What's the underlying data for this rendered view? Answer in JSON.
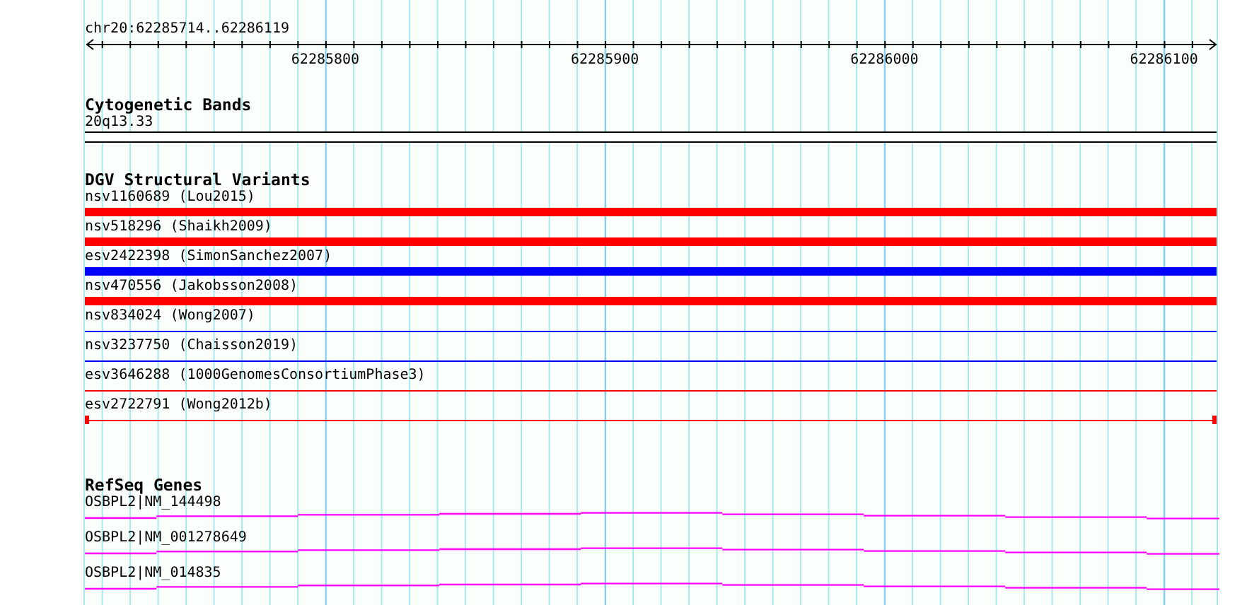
{
  "ruler": {
    "label": "chr20:62285714..62286119",
    "ticks": [
      "62285800",
      "62285900",
      "62286000",
      "62286100"
    ]
  },
  "tracks": [
    {
      "kind": "cytoband",
      "title": "Cytogenetic Bands",
      "features": [
        {
          "label": "20q13.33"
        }
      ]
    },
    {
      "kind": "variants",
      "title": "DGV Structural Variants",
      "features": [
        {
          "label": "nsv1160689 (Lou2015)",
          "kind": "bar",
          "color": "#ff0000"
        },
        {
          "label": "nsv518296 (Shaikh2009)",
          "kind": "bar",
          "color": "#ff0000"
        },
        {
          "label": "esv2422398 (SimonSanchez2007)",
          "kind": "bar",
          "color": "#0000ff"
        },
        {
          "label": "nsv470556 (Jakobsson2008)",
          "kind": "bar",
          "color": "#ff0000"
        },
        {
          "label": "nsv834024 (Wong2007)",
          "kind": "line",
          "color": "#0000ff"
        },
        {
          "label": "nsv3237750 (Chaisson2019)",
          "kind": "line",
          "color": "#0000ff"
        },
        {
          "label": "esv3646288 (1000GenomesConsortiumPhase3)",
          "kind": "line",
          "color": "#ff0000"
        },
        {
          "label": "esv2722791 (Wong2012b)",
          "kind": "capped",
          "color": "#ff0000"
        }
      ]
    },
    {
      "kind": "genes",
      "title": "RefSeq Genes",
      "features": [
        {
          "label": "OSBPL2|NM_144498"
        },
        {
          "label": "OSBPL2|NM_001278649"
        },
        {
          "label": "OSBPL2|NM_014835"
        }
      ]
    }
  ]
}
